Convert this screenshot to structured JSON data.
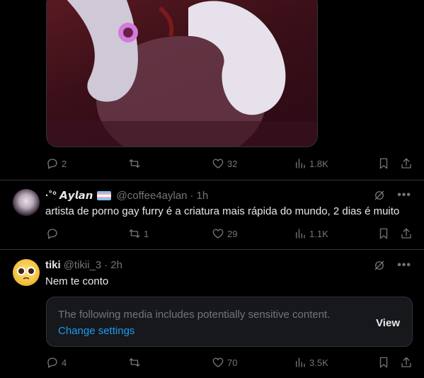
{
  "tweet0": {
    "media_alt": "Illustration of gloved hands",
    "actions": {
      "replies": "2",
      "retweets": "",
      "likes": "32",
      "views": "1.8K"
    }
  },
  "tweet1": {
    "name": "·˚° 𝘼𝙮𝙡𝙖𝙣",
    "handle": "@coffee4aylan",
    "time": "1h",
    "text": "artista de porno gay furry é a criatura mais rápida do mundo, 2 dias é muito",
    "actions": {
      "replies": "",
      "retweets": "1",
      "likes": "29",
      "views": "1.1K"
    }
  },
  "tweet2": {
    "name": "tiki",
    "handle": "@tikii_3",
    "time": "2h",
    "text": "Nem te conto",
    "sensitive": {
      "message": "The following media includes potentially sensitive content.",
      "change_link": "Change settings",
      "view_label": "View"
    },
    "actions": {
      "replies": "4",
      "retweets": "",
      "likes": "70",
      "views": "3.5K"
    }
  },
  "separator": "·",
  "colors": {
    "background": "#000000",
    "text": "#e7e9ea",
    "muted": "#71767b",
    "link": "#1d9bf0",
    "border": "#2f3336"
  }
}
